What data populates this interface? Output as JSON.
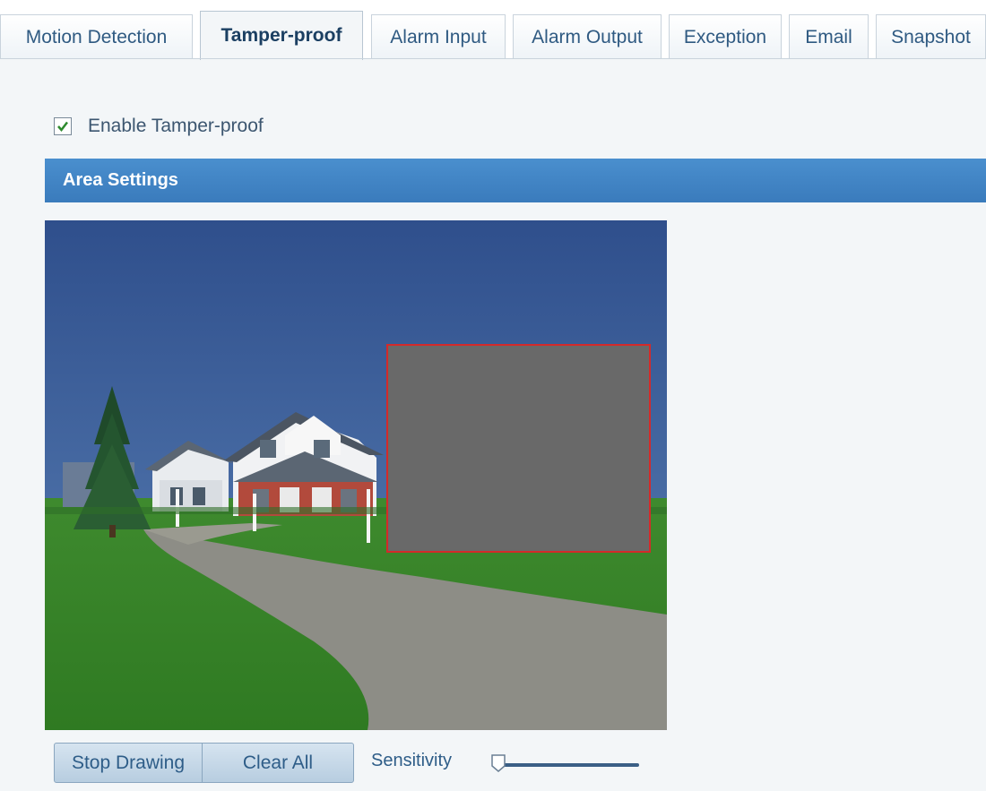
{
  "tabs": [
    {
      "label": "Motion Detection",
      "active": false
    },
    {
      "label": "Tamper-proof",
      "active": true
    },
    {
      "label": "Alarm Input",
      "active": false
    },
    {
      "label": "Alarm Output",
      "active": false
    },
    {
      "label": "Exception",
      "active": false
    },
    {
      "label": "Email",
      "active": false
    },
    {
      "label": "Snapshot",
      "active": false
    }
  ],
  "enable": {
    "label": "Enable Tamper-proof",
    "checked": true
  },
  "section": {
    "title": "Area Settings"
  },
  "controls": {
    "stop_drawing_label": "Stop Drawing",
    "clear_all_label": "Clear All",
    "sensitivity_label": "Sensitivity",
    "sensitivity_value": 0
  },
  "colors": {
    "accent": "#3a7bbc",
    "tamper_border": "#d42a2a",
    "tamper_fill": "#696969"
  },
  "icons": {
    "checkbox": "check-icon",
    "slider": "slider-handle-icon"
  }
}
